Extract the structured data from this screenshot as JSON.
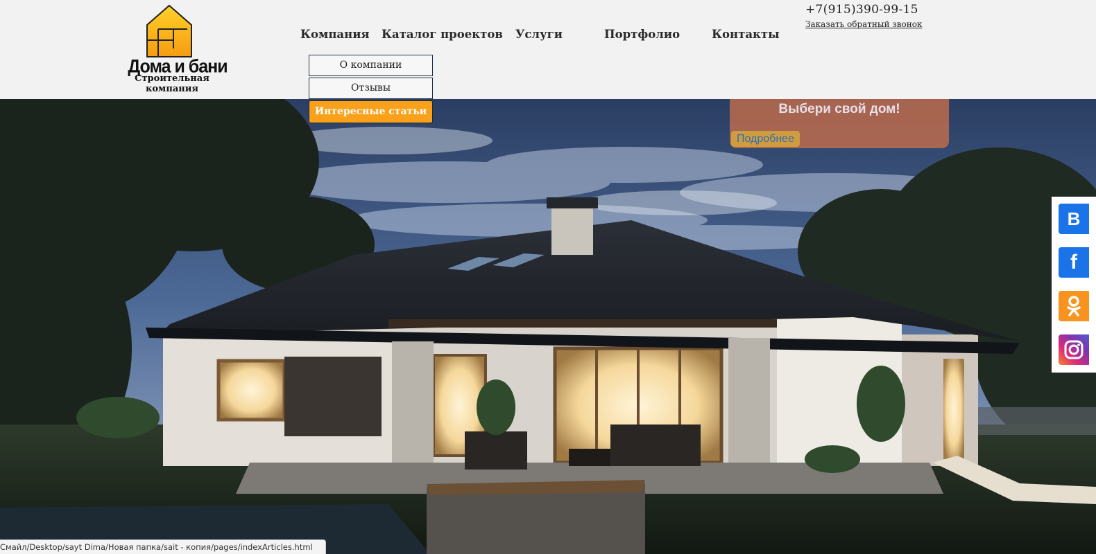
{
  "logo": {
    "name": "Дома и бани",
    "subtitle": "Строительная компания"
  },
  "nav": {
    "items": [
      {
        "label": "Компания"
      },
      {
        "label": "Каталог проектов"
      },
      {
        "label": "Услуги"
      },
      {
        "label": "Портфолио"
      },
      {
        "label": "Контакты"
      }
    ],
    "dropdown": [
      {
        "label": "О компании",
        "active": false
      },
      {
        "label": "Отзывы",
        "active": false
      },
      {
        "label": "Интересные статьи",
        "active": true
      }
    ]
  },
  "contact": {
    "phone": "+7(915)390-99-15",
    "callback": "Заказать обратный звонок"
  },
  "promo": {
    "title": "Выбери свой дом!",
    "button": "Подробнее"
  },
  "social": [
    {
      "icon": "vk-icon",
      "glyph": "B",
      "color": "#1a73e8"
    },
    {
      "icon": "facebook-icon",
      "glyph": "f",
      "color": "#1a73e8"
    },
    {
      "icon": "odnoklassniki-icon",
      "glyph": "ok",
      "color": "#f7931e"
    },
    {
      "icon": "instagram-icon",
      "glyph": "",
      "color": "#c13584"
    }
  ],
  "status_url": "Смайл/Desktop/sayt Dima/Новая папка/sait - копия/pages/indexArticles.html",
  "colors": {
    "accent": "#f9a11b",
    "header_bg": "#f2f2f2",
    "promo_bg": "#c9704a",
    "social_blue": "#1a73e8",
    "social_orange": "#f7931e"
  }
}
